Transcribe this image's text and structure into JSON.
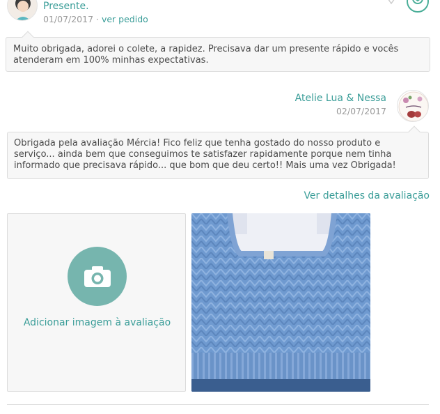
{
  "buyer": {
    "name": "Presente.",
    "date": "01/07/2017",
    "separator": " · ",
    "order_link": "ver pedido"
  },
  "buyer_review": {
    "text": "Muito obrigada, adorei o colete, a rapidez. Precisava dar um presente rápido e vocês atenderam em 100% minhas expectativas."
  },
  "seller": {
    "name": "Atelie Lua & Nessa",
    "date": "02/07/2017"
  },
  "seller_reply": {
    "text": "Obrigada pela avaliação Mércia! Fico feliz que tenha gostado do nosso produto e serviço... ainda bem que conseguimos te satisfazer rapidamente porque nem tinha informado que precisava rápido... que bom que deu certo!! Mais uma vez Obrigada!"
  },
  "review_details_link": "Ver detalhes da avaliação",
  "add_image": {
    "label": "Adicionar imagem à avaliação"
  },
  "icons": {
    "status": "checkmark-circle-icon",
    "favorite": "heart-outline-icon",
    "camera": "camera-icon"
  },
  "colors": {
    "accent": "#3a9d98",
    "camera_circle": "#76b5ae",
    "muted_text": "#9a9a9a"
  }
}
